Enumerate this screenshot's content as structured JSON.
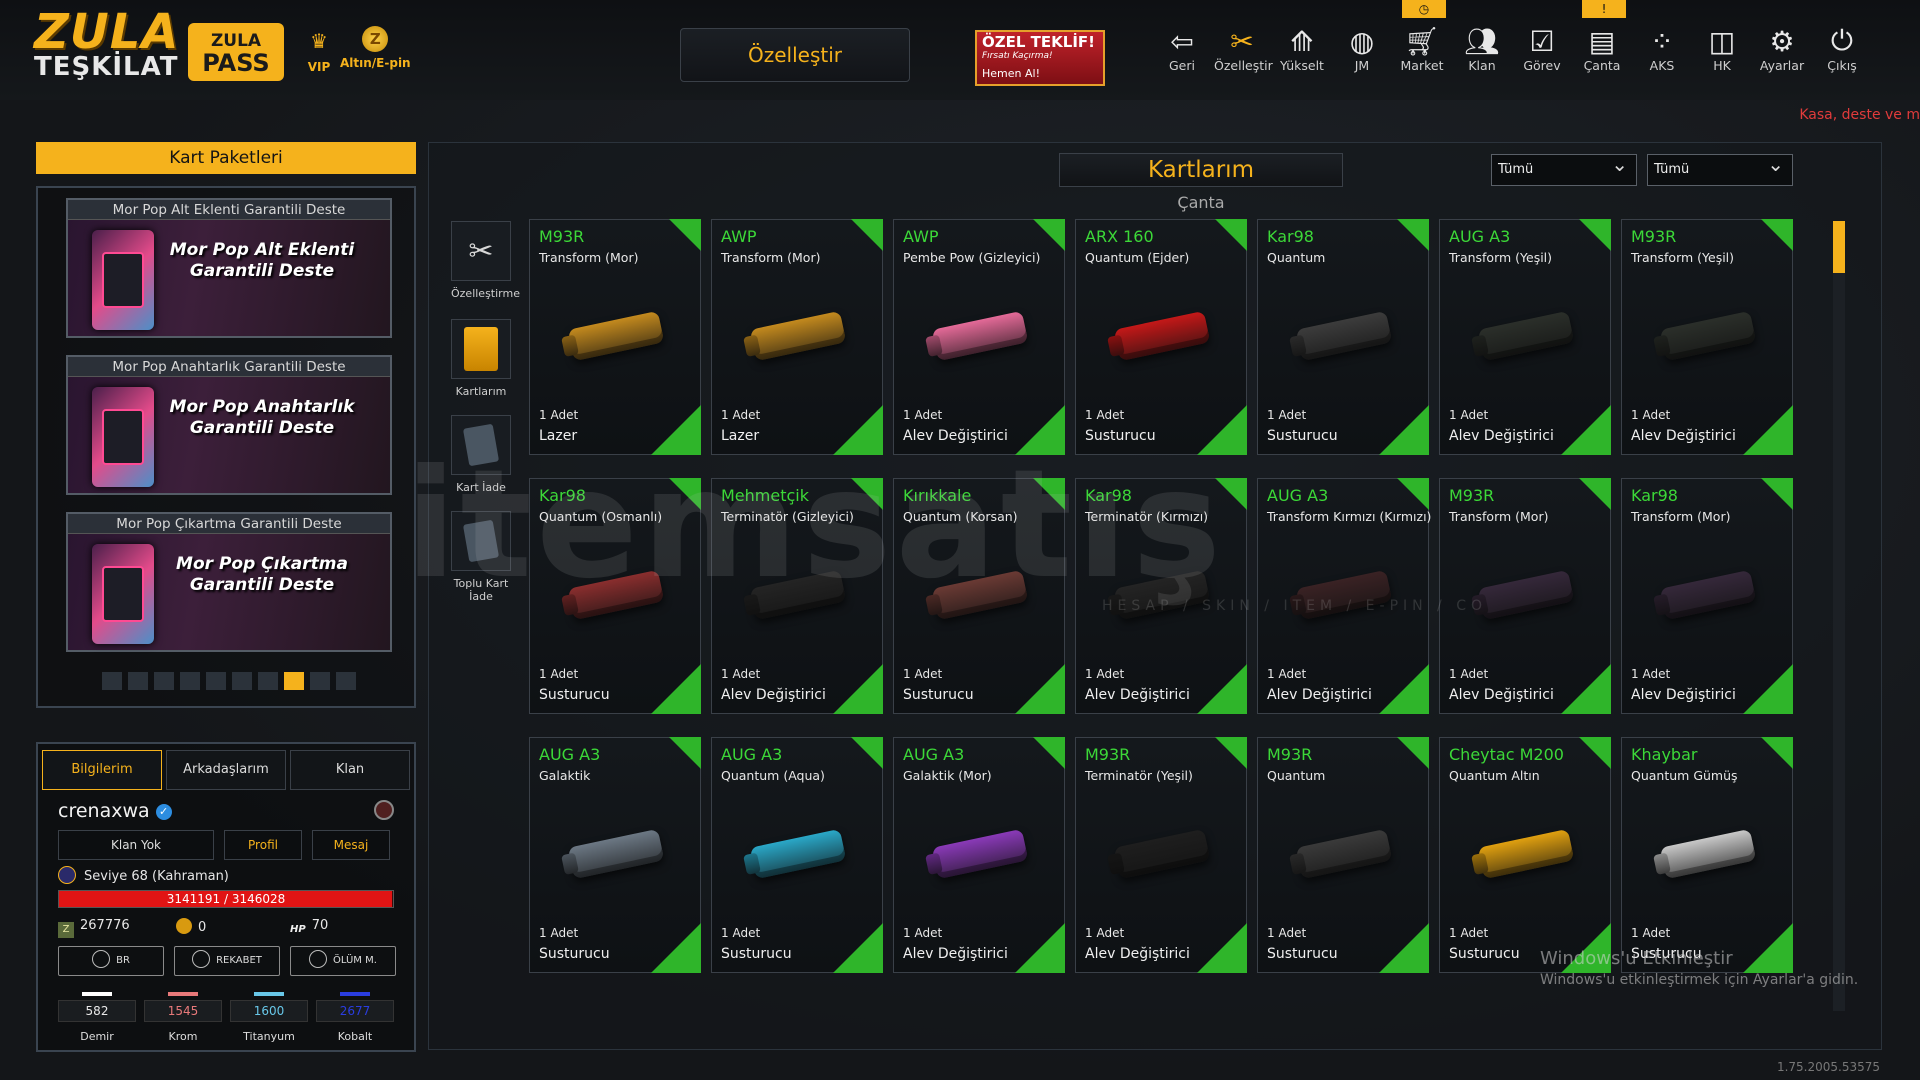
{
  "header": {
    "logo_top": "ZULA",
    "logo_bottom": "TEŞKİLAT",
    "pass_top": "ZULA",
    "pass_bottom": "PASS",
    "vip_label": "VIP",
    "altin_label": "Altın/E-pin",
    "ozellestir_button": "Özelleştir",
    "offer_title": "ÖZEL TEKLİF!",
    "offer_sub": "Fırsatı Kaçırma!",
    "offer_cta": "Hemen Al!",
    "nav": [
      {
        "label": "Geri",
        "icon": "back-icon"
      },
      {
        "label": "Özelleştir",
        "icon": "tools-icon"
      },
      {
        "label": "Yükselt",
        "icon": "upgrade-icon"
      },
      {
        "label": "JM",
        "icon": "coins-icon"
      },
      {
        "label": "Market",
        "icon": "cart-icon"
      },
      {
        "label": "Klan",
        "icon": "clan-icon"
      },
      {
        "label": "Görev",
        "icon": "task-icon"
      },
      {
        "label": "Çanta",
        "icon": "bag-icon"
      },
      {
        "label": "AKS",
        "icon": "aks-icon"
      },
      {
        "label": "HK",
        "icon": "hk-icon"
      },
      {
        "label": "Ayarlar",
        "icon": "gear-icon"
      },
      {
        "label": "Çıkış",
        "icon": "power-icon"
      }
    ],
    "marquee": "Kasa, deste ve m"
  },
  "card_packs": {
    "title": "Kart Paketleri",
    "decks": [
      {
        "header": "Mor Pop Alt Eklenti Garantili Deste",
        "title": "Mor Pop Alt Eklenti Garantili Deste"
      },
      {
        "header": "Mor Pop Anahtarlık Garantili Deste",
        "title": "Mor Pop Anahtarlık Garantili Deste"
      },
      {
        "header": "Mor Pop Çıkartma Garantili Deste",
        "title": "Mor Pop Çıkartma Garantili Deste"
      }
    ],
    "page_count": 10,
    "active_page": 8
  },
  "profile": {
    "tabs": [
      "Bilgilerim",
      "Arkadaşlarım",
      "Klan"
    ],
    "active_tab": "Bilgilerim",
    "username": "crenaxwa",
    "clan_button": "Klan Yok",
    "profile_button": "Profil",
    "message_button": "Mesaj",
    "level_text": "Seviye 68 (Kahraman)",
    "xp_text": "3141191 / 3146028",
    "xp_fraction": 0.998,
    "zula_currency": "267776",
    "gold_currency": "0",
    "hp_currency": "70",
    "hp_label": "HP",
    "mode_buttons": [
      "BR",
      "REKABET",
      "ÖLÜM M."
    ],
    "metals": [
      {
        "name": "Demir",
        "value": "582",
        "color": "#ffffff"
      },
      {
        "name": "Krom",
        "value": "1545",
        "color": "#e8797a"
      },
      {
        "name": "Titanyum",
        "value": "1600",
        "color": "#68c7e8"
      },
      {
        "name": "Kobalt",
        "value": "2677",
        "color": "#2a3de0"
      }
    ]
  },
  "main": {
    "title": "Kartlarım",
    "subtitle": "Çanta",
    "filter1": "Tümü",
    "filter2": "Tümü",
    "side_buttons": [
      {
        "label": "Özelleştirme",
        "icon": "tools-icon"
      },
      {
        "label": "Kartlarım",
        "icon": "card-icon"
      },
      {
        "label": "Kart İade",
        "icon": "card-return-icon"
      },
      {
        "label": "Toplu Kart İade",
        "icon": "bulk-return-icon"
      }
    ],
    "items": [
      {
        "weapon": "M93R",
        "skin": "Transform (Mor)",
        "count": "1 Adet",
        "type": "Lazer",
        "color": "#c48a1e"
      },
      {
        "weapon": "AWP",
        "skin": "Transform (Mor)",
        "count": "1 Adet",
        "type": "Lazer",
        "color": "#c48a1e"
      },
      {
        "weapon": "AWP",
        "skin": "Pembe Pow (Gizleyici)",
        "count": "1 Adet",
        "type": "Alev Değiştirici",
        "color": "#e46a98"
      },
      {
        "weapon": "ARX 160",
        "skin": "Quantum (Ejder)",
        "count": "1 Adet",
        "type": "Susturucu",
        "color": "#c41818"
      },
      {
        "weapon": "Kar98",
        "skin": "Quantum",
        "count": "1 Adet",
        "type": "Susturucu",
        "color": "#3c3c3c"
      },
      {
        "weapon": "AUG A3",
        "skin": "Transform (Yeşil)",
        "count": "1 Adet",
        "type": "Alev Değiştirici",
        "color": "#2b2f2a"
      },
      {
        "weapon": "M93R",
        "skin": "Transform (Yeşil)",
        "count": "1 Adet",
        "type": "Alev Değiştirici",
        "color": "#2b2f2a"
      },
      {
        "weapon": "Kar98",
        "skin": "Quantum (Osmanlı)",
        "count": "1 Adet",
        "type": "Susturucu",
        "color": "#8a2e2e"
      },
      {
        "weapon": "Mehmetçik",
        "skin": "Terminatör (Gizleyici)",
        "count": "1 Adet",
        "type": "Alev Değiştirici",
        "color": "#242424"
      },
      {
        "weapon": "Kırıkkale",
        "skin": "Quantum (Korsan)",
        "count": "1 Adet",
        "type": "Susturucu",
        "color": "#6a3a34"
      },
      {
        "weapon": "Kar98",
        "skin": "Terminatör (Kırmızı)",
        "count": "1 Adet",
        "type": "Alev Değiştirici",
        "color": "#242424"
      },
      {
        "weapon": "AUG A3",
        "skin": "Transform Kırmızı (Kırmızı)",
        "count": "1 Adet",
        "type": "Alev Değiştirici",
        "color": "#3a2224"
      },
      {
        "weapon": "M93R",
        "skin": "Transform (Mor)",
        "count": "1 Adet",
        "type": "Alev Değiştirici",
        "color": "#35283a"
      },
      {
        "weapon": "Kar98",
        "skin": "Transform (Mor)",
        "count": "1 Adet",
        "type": "Alev Değiştirici",
        "color": "#35283a"
      },
      {
        "weapon": "AUG A3",
        "skin": "Galaktik",
        "count": "1 Adet",
        "type": "Susturucu",
        "color": "#6c7884"
      },
      {
        "weapon": "AUG A3",
        "skin": "Quantum (Aqua)",
        "count": "1 Adet",
        "type": "Susturucu",
        "color": "#2aa8c8"
      },
      {
        "weapon": "AUG A3",
        "skin": "Galaktik (Mor)",
        "count": "1 Adet",
        "type": "Alev Değiştirici",
        "color": "#8a3ab8"
      },
      {
        "weapon": "M93R",
        "skin": "Terminatör (Yeşil)",
        "count": "1 Adet",
        "type": "Alev Değiştirici",
        "color": "#1e1e1e"
      },
      {
        "weapon": "M93R",
        "skin": "Quantum",
        "count": "1 Adet",
        "type": "Susturucu",
        "color": "#3a3a3a"
      },
      {
        "weapon": "Cheytac M200",
        "skin": "Quantum Altın",
        "count": "1 Adet",
        "type": "Susturucu",
        "color": "#e0a010"
      },
      {
        "weapon": "Khaybar",
        "skin": "Quantum Gümüş",
        "count": "1 Adet",
        "type": "Susturucu",
        "color": "#c8c8c8"
      }
    ]
  },
  "overlay": {
    "watermark": "itemsatış",
    "watermark_sub": "HESAP / SKIN / ITEM / E-PIN / CO",
    "activation_title": "Windows'u Etkinleştir",
    "activation_text": "Windows'u etkinleştirmek için Ayarlar'a gidin.",
    "version": "1.75.2005.53575"
  }
}
